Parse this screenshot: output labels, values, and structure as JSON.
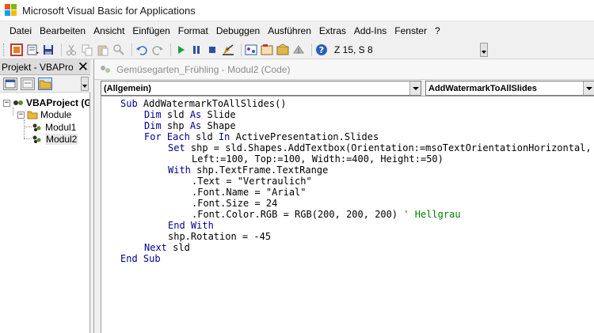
{
  "window": {
    "title": "Microsoft Visual Basic for Applications"
  },
  "menu": {
    "items": [
      "Datei",
      "Bearbeiten",
      "Ansicht",
      "Einfügen",
      "Format",
      "Debuggen",
      "Ausführen",
      "Extras",
      "Add-Ins",
      "Fenster",
      "?"
    ]
  },
  "toolbar": {
    "cursor_position": "Z 15, S 8"
  },
  "project_panel": {
    "title": "Projekt - VBAProje",
    "tree": {
      "root": "VBAProject (G",
      "folder": "Module",
      "modules": [
        "Modul1",
        "Modul2"
      ]
    }
  },
  "code_window": {
    "title": "Gemüsegarten_Frühling - Modul2 (Code)",
    "object_combo": "(Allgemein)",
    "procedure_combo": "AddWatermarkToAllSlides"
  },
  "code": {
    "l1_kw": "Sub",
    "l1_rest": " AddWatermarkToAllSlides()",
    "l2_kw": "Dim",
    "l2_rest": " sld ",
    "l2_kw2": "As",
    "l2_rest2": " Slide",
    "l3_kw": "Dim",
    "l3_rest": " shp ",
    "l3_kw2": "As",
    "l3_rest2": " Shape",
    "l4_kw": "For Each",
    "l4_rest": " sld ",
    "l4_kw2": "In",
    "l4_rest2": " ActivePresentation.Slides",
    "l5_kw": "Set",
    "l5_rest": " shp = sld.Shapes.AddTextbox(Orientation:=msoTextOrientationHorizontal, _",
    "l6": "Left:=100, Top:=100, Width:=400, Height:=50)",
    "l7_kw": "With",
    "l7_rest": " shp.TextFrame.TextRange",
    "l8": ".Text = \"Vertraulich\"",
    "l9": ".Font.Name = \"Arial\"",
    "l10": ".Font.Size = 24",
    "l11_code": ".Font.Color.RGB = RGB(200, 200, 200) ",
    "l11_comment": "' Hellgrau",
    "l12_kw": "End With",
    "l13": "shp.Rotation = -45",
    "l14_kw": "Next",
    "l14_rest": " sld",
    "l15_kw": "End Sub"
  },
  "colors": {
    "keyword": "#00008b",
    "comment": "#008000"
  }
}
